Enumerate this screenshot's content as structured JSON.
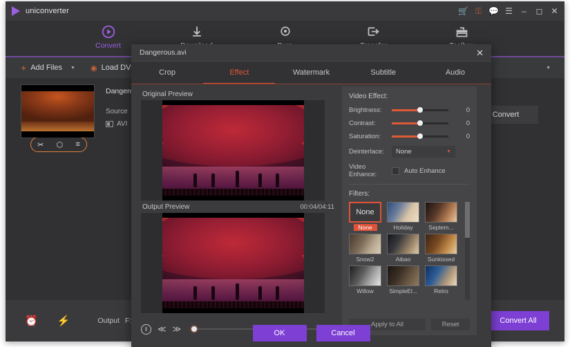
{
  "app": {
    "brand": "uniconverter",
    "window_icons": [
      {
        "name": "cart-icon",
        "glyph": "☗"
      },
      {
        "name": "key-icon",
        "glyph": "⚷"
      },
      {
        "name": "feedback-icon",
        "glyph": "▭"
      },
      {
        "name": "menu-icon",
        "glyph": "☰"
      },
      {
        "name": "minimize-icon",
        "glyph": "–"
      },
      {
        "name": "maximize-icon",
        "glyph": "□"
      },
      {
        "name": "close-icon",
        "glyph": "✕"
      }
    ]
  },
  "nav": {
    "items": [
      {
        "label": "Convert",
        "icon": "convert-icon",
        "active": true
      },
      {
        "label": "Download",
        "icon": "download-icon",
        "active": false
      },
      {
        "label": "Burn",
        "icon": "burn-icon",
        "active": false
      },
      {
        "label": "Transfer",
        "icon": "transfer-icon",
        "active": false
      },
      {
        "label": "Toolbox",
        "icon": "toolbox-icon",
        "active": false
      }
    ]
  },
  "toolbar": {
    "add_files": "Add Files",
    "load_dvd": "Load DVD"
  },
  "file": {
    "name": "Dangerous",
    "source_label": "Source",
    "format": "AVI",
    "convert_button": "Convert",
    "edit_icons": [
      {
        "name": "trim-icon",
        "glyph": "✂"
      },
      {
        "name": "crop-icon",
        "glyph": "⧉"
      },
      {
        "name": "effect-icon",
        "glyph": "≡"
      }
    ]
  },
  "bottom": {
    "timer_icon": "alarm-icon",
    "bolt_icon": "bolt-icon",
    "output_label": "Output",
    "output_path": "F:\\Wondersha",
    "convert_all": "Convert All"
  },
  "dialog": {
    "title": "Dangerous.avi",
    "close_glyph": "✕",
    "tabs": [
      {
        "label": "Crop",
        "active": false
      },
      {
        "label": "Effect",
        "active": true
      },
      {
        "label": "Watermark",
        "active": false
      },
      {
        "label": "Subtitle",
        "active": false
      },
      {
        "label": "Audio",
        "active": false
      }
    ],
    "original_preview_label": "Original Preview",
    "output_preview_label": "Output Preview",
    "output_time": "00:04/04:11",
    "player": {
      "pause_glyph": "‖",
      "prev_glyph": "≪",
      "next_glyph": "≫"
    },
    "settings": {
      "video_effect_title": "Video Effect:",
      "rows": [
        {
          "label": "Brightness:",
          "value": "0"
        },
        {
          "label": "Contrast:",
          "value": "0"
        },
        {
          "label": "Saturation:",
          "value": "0"
        }
      ],
      "deinterlace_label": "Deinterlace:",
      "deinterlace_value": "None",
      "video_enhance_label": "Video Enhance:",
      "auto_enhance_label": "Auto Enhance",
      "filters_title": "Filters:",
      "filters": [
        {
          "name": "None",
          "selected": true
        },
        {
          "name": "Holiday",
          "selected": false
        },
        {
          "name": "Septem...",
          "selected": false
        },
        {
          "name": "Snow2",
          "selected": false
        },
        {
          "name": "Aibao",
          "selected": false
        },
        {
          "name": "Sunkissed",
          "selected": false
        },
        {
          "name": "Willow",
          "selected": false
        },
        {
          "name": "SimpleEl...",
          "selected": false
        },
        {
          "name": "Retro",
          "selected": false
        }
      ],
      "apply_to_all": "Apply to All",
      "reset": "Reset"
    },
    "ok": "OK",
    "cancel": "Cancel"
  },
  "colors": {
    "accent_purple": "#7d3fd4",
    "accent_orange": "#e0533a",
    "window_bg": "#323234",
    "panel_bg": "#454547"
  }
}
